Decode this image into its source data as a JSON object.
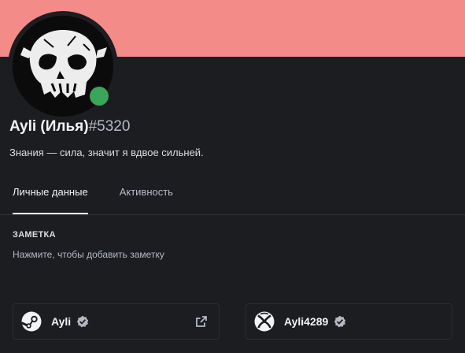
{
  "profile": {
    "banner_color": "#f38b89",
    "status": "online",
    "status_color": "#3ba55c",
    "username": "Ayli (Илья)",
    "discriminator": "#5320",
    "about": "Знания — сила, значит я вдвое сильней."
  },
  "tabs": [
    {
      "label": "Личные данные",
      "active": true
    },
    {
      "label": "Активность",
      "active": false
    }
  ],
  "note": {
    "heading": "ЗАМЕТКА",
    "placeholder": "Нажмите, чтобы добавить заметку"
  },
  "connections": [
    {
      "platform": "steam",
      "icon": "steam-icon",
      "name": "Ayli",
      "verified": true,
      "external_link": true
    },
    {
      "platform": "xbox",
      "icon": "xbox-icon",
      "name": "Ayli4289",
      "verified": true,
      "external_link": false
    }
  ]
}
